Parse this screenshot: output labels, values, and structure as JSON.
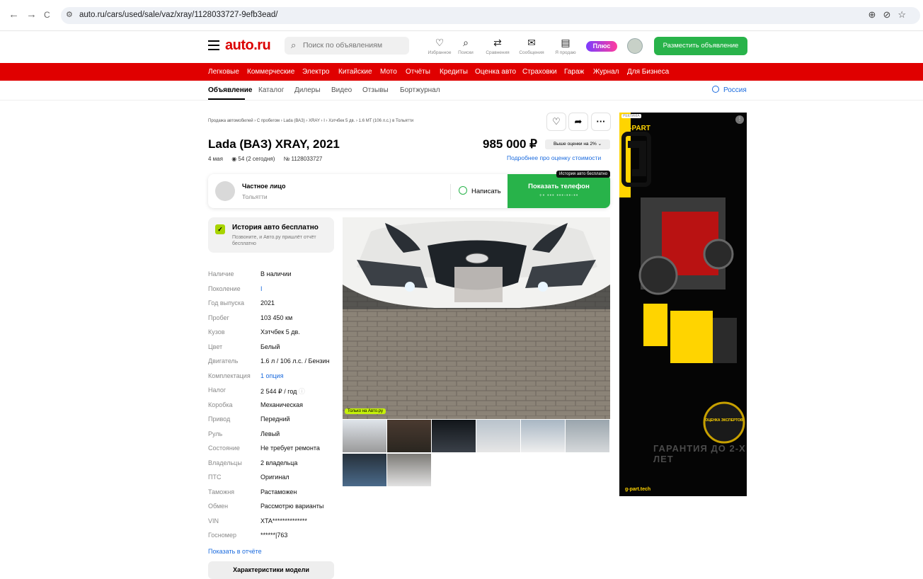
{
  "browser": {
    "url": "auto.ru/cars/used/sale/vaz/xray/1128033727-9efb3ead/",
    "back": "←",
    "forward": "→",
    "reload": "C"
  },
  "header": {
    "logo": "auto.ru",
    "search_placeholder": "Поиск по объявлениям",
    "icons": [
      {
        "glyph": "♡",
        "label": "Избранное",
        "icon": "heart-icon"
      },
      {
        "glyph": "⌕",
        "label": "Поиски",
        "icon": "search-saved-icon"
      },
      {
        "glyph": "⇄",
        "label": "Сравнения",
        "icon": "compare-icon"
      },
      {
        "glyph": "✉",
        "label": "Сообщения",
        "icon": "messages-icon"
      },
      {
        "glyph": "▤",
        "label": "Я продаю",
        "icon": "selling-icon"
      }
    ],
    "plus": "Плюс",
    "place_ad": "Разместить объявление"
  },
  "rednav": [
    "Легковые",
    "Коммерческие",
    "Электро",
    "Китайские",
    "Мото",
    "Отчёты",
    "Кредиты",
    "Оценка авто",
    "Страховки",
    "Гараж",
    "Журнал",
    "Для Бизнеса"
  ],
  "tabs": [
    "Объявление",
    "Каталог",
    "Дилеры",
    "Видео",
    "Отзывы",
    "Бортжурнал"
  ],
  "region": "Россия",
  "breadcrumb": "Продажа автомобилей  ›  С пробегом  ›  Lada (ВАЗ)  ›  XRAY  ›  I  ›  Хэтчбек 5 дв.  ›  1.6 MT (106 л.с.) в Тольятти",
  "listing": {
    "title": "Lada (ВАЗ) XRAY, 2021",
    "date": "4 мая",
    "views": "54 (2 сегодня)",
    "number": "№ 1128033727",
    "price": "985 000 ₽",
    "price_badge": "Выше оценки на 2%",
    "price_more": "Подробнее про оценку стоимости"
  },
  "seller": {
    "name": "Частное лицо",
    "city": "Тольятти",
    "write": "Написать",
    "phone": "Показать телефон",
    "phone_mask": "+• ••• •••-••-••",
    "tooltip": "История авто бесплатно"
  },
  "history": {
    "title": "История авто бесплатно",
    "subtitle": "Позвоните, и Авто.ру пришлёт отчёт бесплатно"
  },
  "specs": [
    {
      "k": "Наличие",
      "v": "В наличии"
    },
    {
      "k": "Поколение",
      "v": "I",
      "link": true
    },
    {
      "k": "Год выпуска",
      "v": "2021"
    },
    {
      "k": "Пробег",
      "v": "103 450 км"
    },
    {
      "k": "Кузов",
      "v": "Хэтчбек 5 дв."
    },
    {
      "k": "Цвет",
      "v": "Белый"
    },
    {
      "k": "Двигатель",
      "v": "1.6 л / 106 л.с. / Бензин"
    },
    {
      "k": "Комплектация",
      "v": "1 опция",
      "link": true
    },
    {
      "k": "Налог",
      "v": "2 544 ₽ / год"
    },
    {
      "k": "Коробка",
      "v": "Механическая"
    },
    {
      "k": "Привод",
      "v": "Передний"
    },
    {
      "k": "Руль",
      "v": "Левый"
    },
    {
      "k": "Состояние",
      "v": "Не требует ремонта"
    },
    {
      "k": "Владельцы",
      "v": "2 владельца"
    },
    {
      "k": "ПТС",
      "v": "Оригинал"
    },
    {
      "k": "Таможня",
      "v": "Растаможен"
    },
    {
      "k": "Обмен",
      "v": "Рассмотрю варианты"
    },
    {
      "k": "VIN",
      "v": "XTA**************"
    },
    {
      "k": "Госномер",
      "v": "******|763"
    }
  ],
  "show_report": "Показать в отчёте",
  "model_btn": "Характеристики модели",
  "only_badge": "Только на Авто.ру",
  "ad": {
    "label": "РЕКЛАМА",
    "brand": "g-PART",
    "guarantee": "ГАРАНТИЯ ДО 2-Х ЛЕТ",
    "stamp": "ОЦЕНКА ЭКСПЕРТОВ",
    "domain": "g-part.tech"
  }
}
